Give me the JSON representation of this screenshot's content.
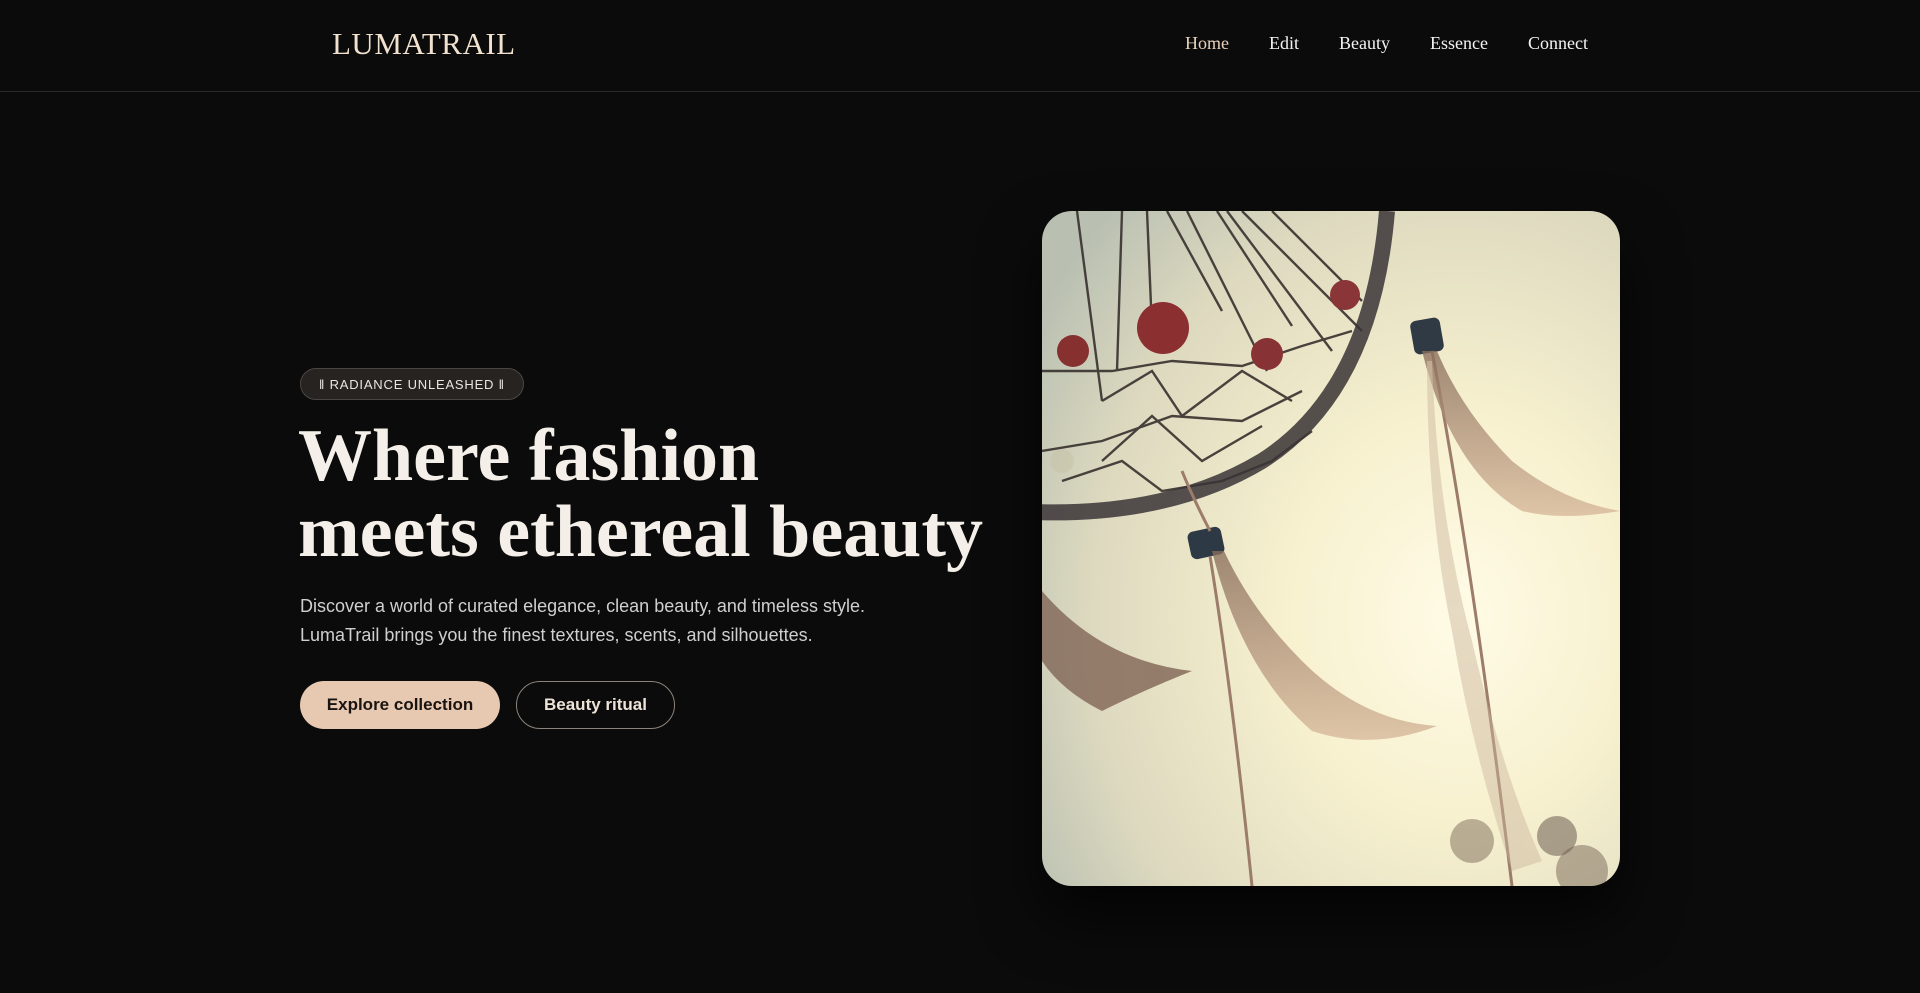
{
  "header": {
    "logo": "LUMATRAIL",
    "nav": [
      "Home",
      "Edit",
      "Beauty",
      "Essence",
      "Connect"
    ],
    "active_index": 0
  },
  "hero": {
    "badge": "‖ RADIANCE UNLEASHED ‖",
    "headline_line1": "Where fashion",
    "headline_line2": "meets ethereal beauty",
    "lead_line1": "Discover a world of curated elegance, clean beauty, and timeless style.",
    "lead_line2": "LumaTrail brings you the finest textures, scents, and silhouettes.",
    "primary_button": "Explore collection",
    "secondary_button": "Beauty ritual"
  },
  "colors": {
    "background": "#0b0b0b",
    "accent": "#e7c8b0",
    "text": "#f4efe9"
  }
}
